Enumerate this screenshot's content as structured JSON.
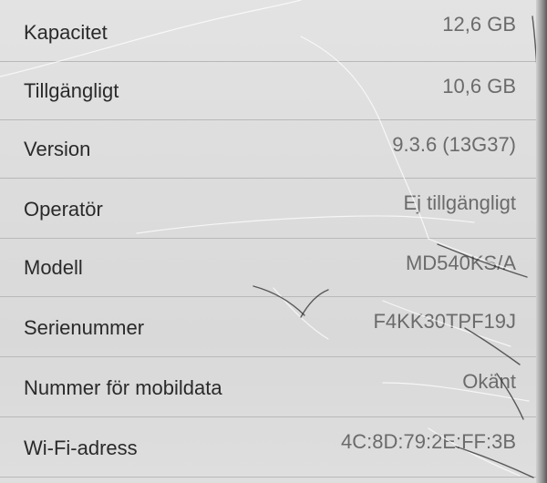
{
  "about": {
    "rows": [
      {
        "label": "Kapacitet",
        "value": "12,6 GB"
      },
      {
        "label": "Tillgängligt",
        "value": "10,6 GB"
      },
      {
        "label": "Version",
        "value": "9.3.6 (13G37)"
      },
      {
        "label": "Operatör",
        "value": "Ej tillgängligt"
      },
      {
        "label": "Modell",
        "value": "MD540KS/A"
      },
      {
        "label": "Serienummer",
        "value": "F4KK30TPF19J"
      },
      {
        "label": "Nummer för mobildata",
        "value": "Okänt"
      },
      {
        "label": "Wi-Fi-adress",
        "value": "4C:8D:79:2E:FF:3B"
      }
    ]
  }
}
